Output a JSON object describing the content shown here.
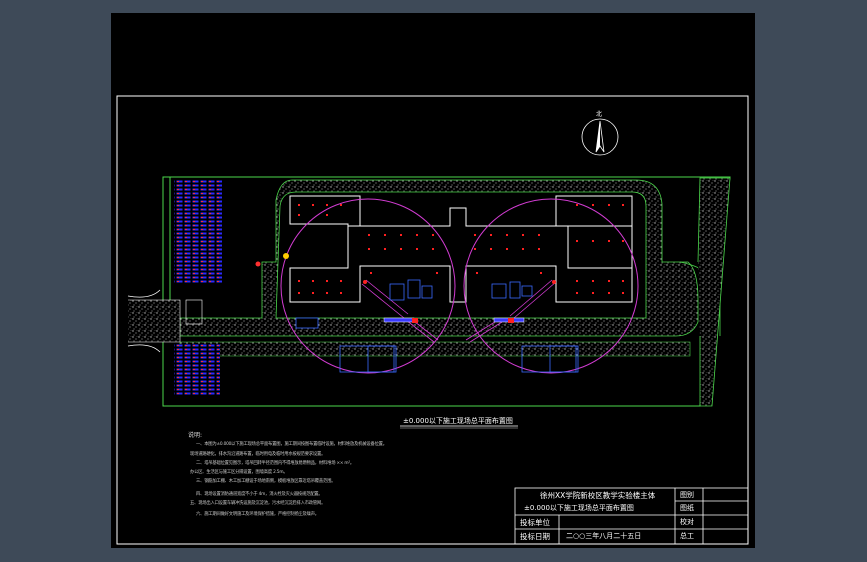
{
  "drawing": {
    "north_label": "北",
    "title": "±0.000以下施工现场总平面布置图",
    "notes_heading": "说明:",
    "notes": [
      "一、本图为±0.000以下施工现场总平面布置图，施工期间按图布置临时设施，材料堆放及机械设备位置。",
      "现场道路硬化，排水沟沿道路布置，临时用电及临时用水按规范要求设置。",
      "二、塔吊基础位置见图示，塔吊回转半径范围内不得堆放易燃物品，材料堆场 ×× m²。",
      "办公区、生活区与施工区分隔设置，围墙高度 2.5m。",
      "三、钢筋加工棚、木工加工棚设于场地南侧，模板堆放区靠近塔吊覆盖范围。",
      "四、现场设置消防通道宽度不小于 4m，消火栓及灭火器按规范配置。",
      "五、现场出入口设置车辆冲洗设施及沉淀池，污水经沉淀后排入市政管网。",
      "六、施工期间做好文明施工及环境保护措施，严格控制扬尘及噪声。"
    ],
    "title_block": {
      "project_line1": "徐州XX学院新校区教学实验楼主体",
      "project_line2": "±0.000以下施工现场总平面布置图",
      "label_unit": "投标单位",
      "label_date": "投标日期",
      "date_value": "二○○三年八月二十五日",
      "right_labels": [
        "图别",
        "图纸",
        "校对",
        "总工"
      ],
      "right_values": [
        "",
        "",
        "",
        ""
      ]
    }
  },
  "colors": {
    "background": "#3e4a58",
    "sheet": "#000000",
    "frame": "#ffffff",
    "site_green": "#4cd84c",
    "crane_circle": "#d23cd2",
    "building": "#ffffff",
    "marker_red": "#ff2020",
    "storage_blue": "#3a3aff"
  },
  "icons": {
    "north_arrow": "north-arrow-icon"
  }
}
